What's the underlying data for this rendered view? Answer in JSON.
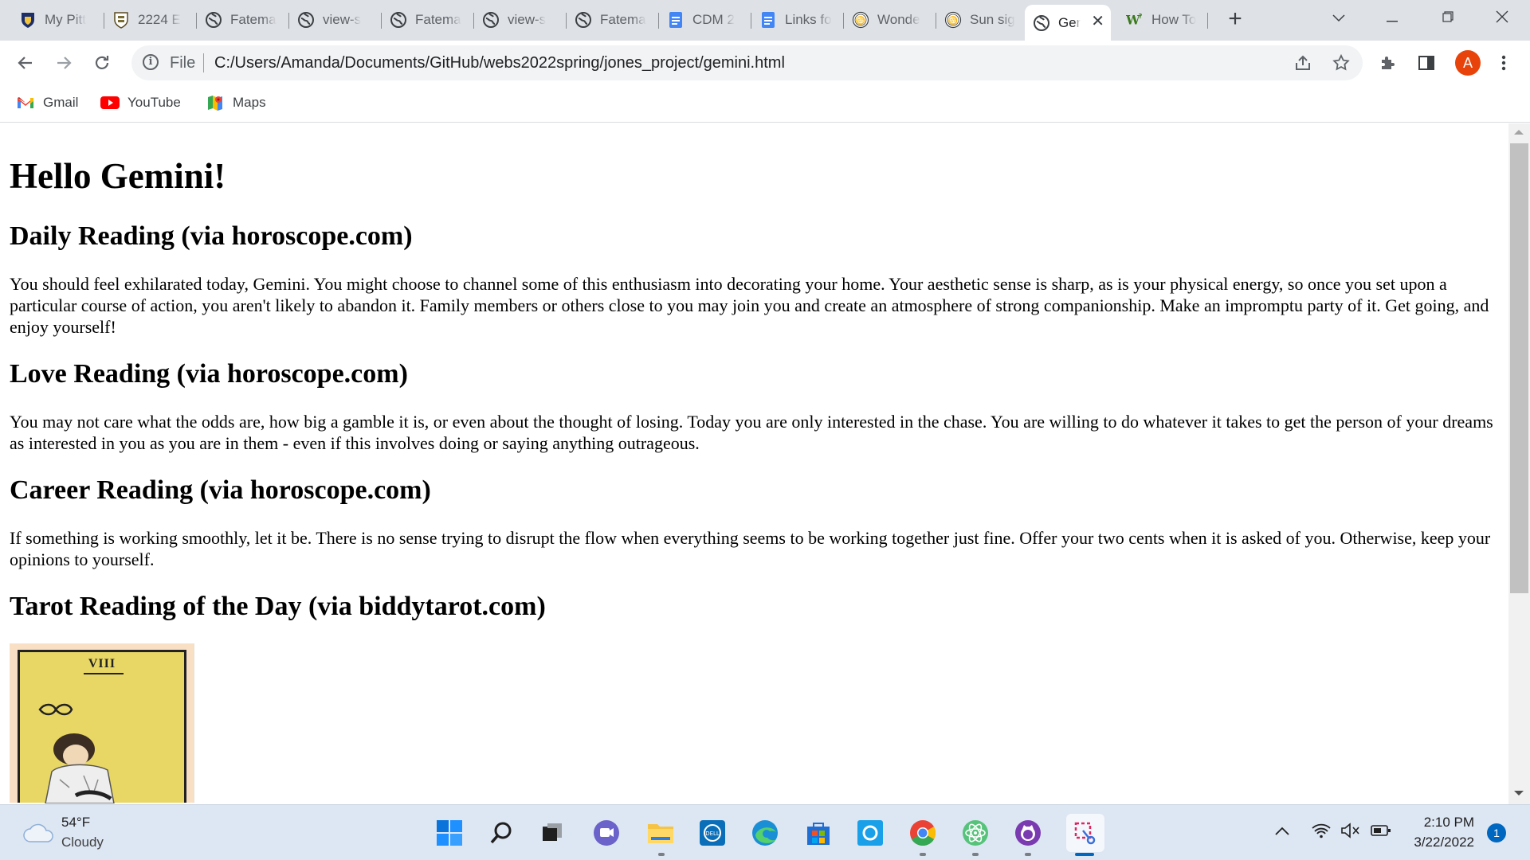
{
  "browser": {
    "tabs": [
      {
        "label": "My Pitt",
        "icon": "pitt-shield-icon"
      },
      {
        "label": "2224 E",
        "icon": "crest-icon"
      },
      {
        "label": "Fatema",
        "icon": "globe-icon"
      },
      {
        "label": "view-s",
        "icon": "globe-icon"
      },
      {
        "label": "Fatema",
        "icon": "globe-icon"
      },
      {
        "label": "view-s",
        "icon": "globe-icon"
      },
      {
        "label": "Fatema",
        "icon": "globe-icon"
      },
      {
        "label": "CDM 2",
        "icon": "google-docs-icon"
      },
      {
        "label": "Links fo",
        "icon": "google-docs-icon"
      },
      {
        "label": "Wonde",
        "icon": "zodiac-icon"
      },
      {
        "label": "Sun sig",
        "icon": "zodiac-icon"
      },
      {
        "label": "Gem",
        "icon": "globe-icon",
        "active": true
      },
      {
        "label": "How To",
        "icon": "wikihow-icon"
      }
    ],
    "new_tab": "+",
    "close_tab": "✕",
    "address": {
      "scheme": "File",
      "url": "C:/Users/Amanda/Documents/GitHub/webs2022spring/jones_project/gemini.html"
    },
    "profile_initial": "A",
    "bookmarks": [
      {
        "label": "Gmail",
        "icon": "gmail-icon"
      },
      {
        "label": "YouTube",
        "icon": "youtube-icon"
      },
      {
        "label": "Maps",
        "icon": "maps-icon"
      }
    ]
  },
  "page": {
    "title": "Hello Gemini!",
    "sections": [
      {
        "heading": "Daily Reading (via horoscope.com)",
        "text": "You should feel exhilarated today, Gemini. You might choose to channel some of this enthusiasm into decorating your home. Your aesthetic sense is sharp, as is your physical energy, so once you set upon a particular course of action, you aren't likely to abandon it. Family members or others close to you may join you and create an atmosphere of strong companionship. Make an impromptu party of it. Get going, and enjoy yourself!"
      },
      {
        "heading": "Love Reading (via horoscope.com)",
        "text": "You may not care what the odds are, how big a gamble it is, or even about the thought of losing. Today you are only interested in the chase. You are willing to do whatever it takes to get the person of your dreams as interested in you as you are in them - even if this involves doing or saying anything outrageous."
      },
      {
        "heading": "Career Reading (via horoscope.com)",
        "text": "If something is working smoothly, let it be. There is no sense trying to disrupt the flow when everything seems to be working together just fine. Offer your two cents when it is asked of you. Otherwise, keep your opinions to yourself."
      },
      {
        "heading": "Tarot Reading of the Day (via biddytarot.com)",
        "text": ""
      }
    ],
    "tarot_card_numeral": "VIII"
  },
  "taskbar": {
    "weather_temp": "54°F",
    "weather_condition": "Cloudy",
    "time": "2:10 PM",
    "date": "3/22/2022",
    "notification_count": "1"
  },
  "colors": {
    "tab_strip": "#dee1e6",
    "profile_avatar": "#e8430a",
    "taskbar": "#dde6f3",
    "tarot_card": "#e8d765"
  }
}
